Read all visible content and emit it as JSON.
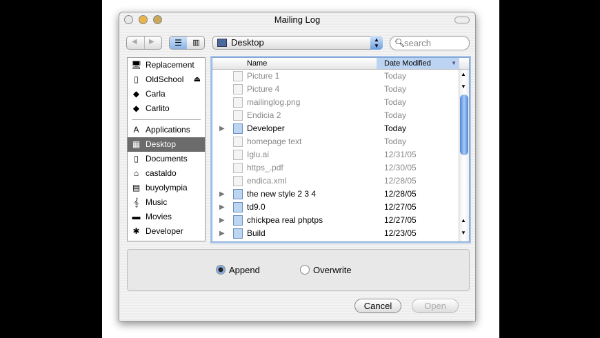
{
  "window": {
    "title": "Mailing Log"
  },
  "toolbar": {
    "location": "Desktop",
    "search_placeholder": "search"
  },
  "sidebar": {
    "devices": [
      {
        "label": "Replacement",
        "icon": "computer-icon"
      },
      {
        "label": "OldSchool",
        "icon": "ipod-icon",
        "eject": "⏏"
      },
      {
        "label": "Carla",
        "icon": "disk-icon"
      },
      {
        "label": "Carlito",
        "icon": "disk-icon"
      }
    ],
    "places": [
      {
        "label": "Applications",
        "icon": "applications-icon"
      },
      {
        "label": "Desktop",
        "icon": "desktop-icon",
        "selected": true
      },
      {
        "label": "Documents",
        "icon": "document-icon"
      },
      {
        "label": "castaldo",
        "icon": "home-icon"
      },
      {
        "label": "buyolympia",
        "icon": "folder-icon"
      },
      {
        "label": "Music",
        "icon": "music-icon"
      },
      {
        "label": "Movies",
        "icon": "movies-icon"
      },
      {
        "label": "Developer",
        "icon": "developer-icon"
      }
    ]
  },
  "list": {
    "col_name": "Name",
    "col_date": "Date Modified",
    "sort": "▼",
    "rows": [
      {
        "name": "Picture 1",
        "date": "Today",
        "enabled": false,
        "folder": false
      },
      {
        "name": "Picture 4",
        "date": "Today",
        "enabled": false,
        "folder": false
      },
      {
        "name": "mailinglog.png",
        "date": "Today",
        "enabled": false,
        "folder": false
      },
      {
        "name": "Endicia 2",
        "date": "Today",
        "enabled": false,
        "folder": false
      },
      {
        "name": "Developer",
        "date": "Today",
        "enabled": true,
        "folder": true
      },
      {
        "name": "homepage text",
        "date": "Today",
        "enabled": false,
        "folder": false
      },
      {
        "name": "Iglu.ai",
        "date": "12/31/05",
        "enabled": false,
        "folder": false
      },
      {
        "name": "https_.pdf",
        "date": "12/30/05",
        "enabled": false,
        "folder": false
      },
      {
        "name": "endica.xml",
        "date": "12/28/05",
        "enabled": false,
        "folder": false
      },
      {
        "name": "the new style 2 3 4",
        "date": "12/28/05",
        "enabled": true,
        "folder": true
      },
      {
        "name": "td9.0",
        "date": "12/27/05",
        "enabled": true,
        "folder": true
      },
      {
        "name": "chickpea real phptps",
        "date": "12/27/05",
        "enabled": true,
        "folder": true
      },
      {
        "name": "Build",
        "date": "12/23/05",
        "enabled": true,
        "folder": true
      }
    ]
  },
  "options": {
    "append": "Append",
    "overwrite": "Overwrite",
    "selected": "append"
  },
  "buttons": {
    "cancel": "Cancel",
    "open": "Open"
  },
  "colors": {
    "accent": "#6b9ee0",
    "selection": "#6b6b6b"
  }
}
